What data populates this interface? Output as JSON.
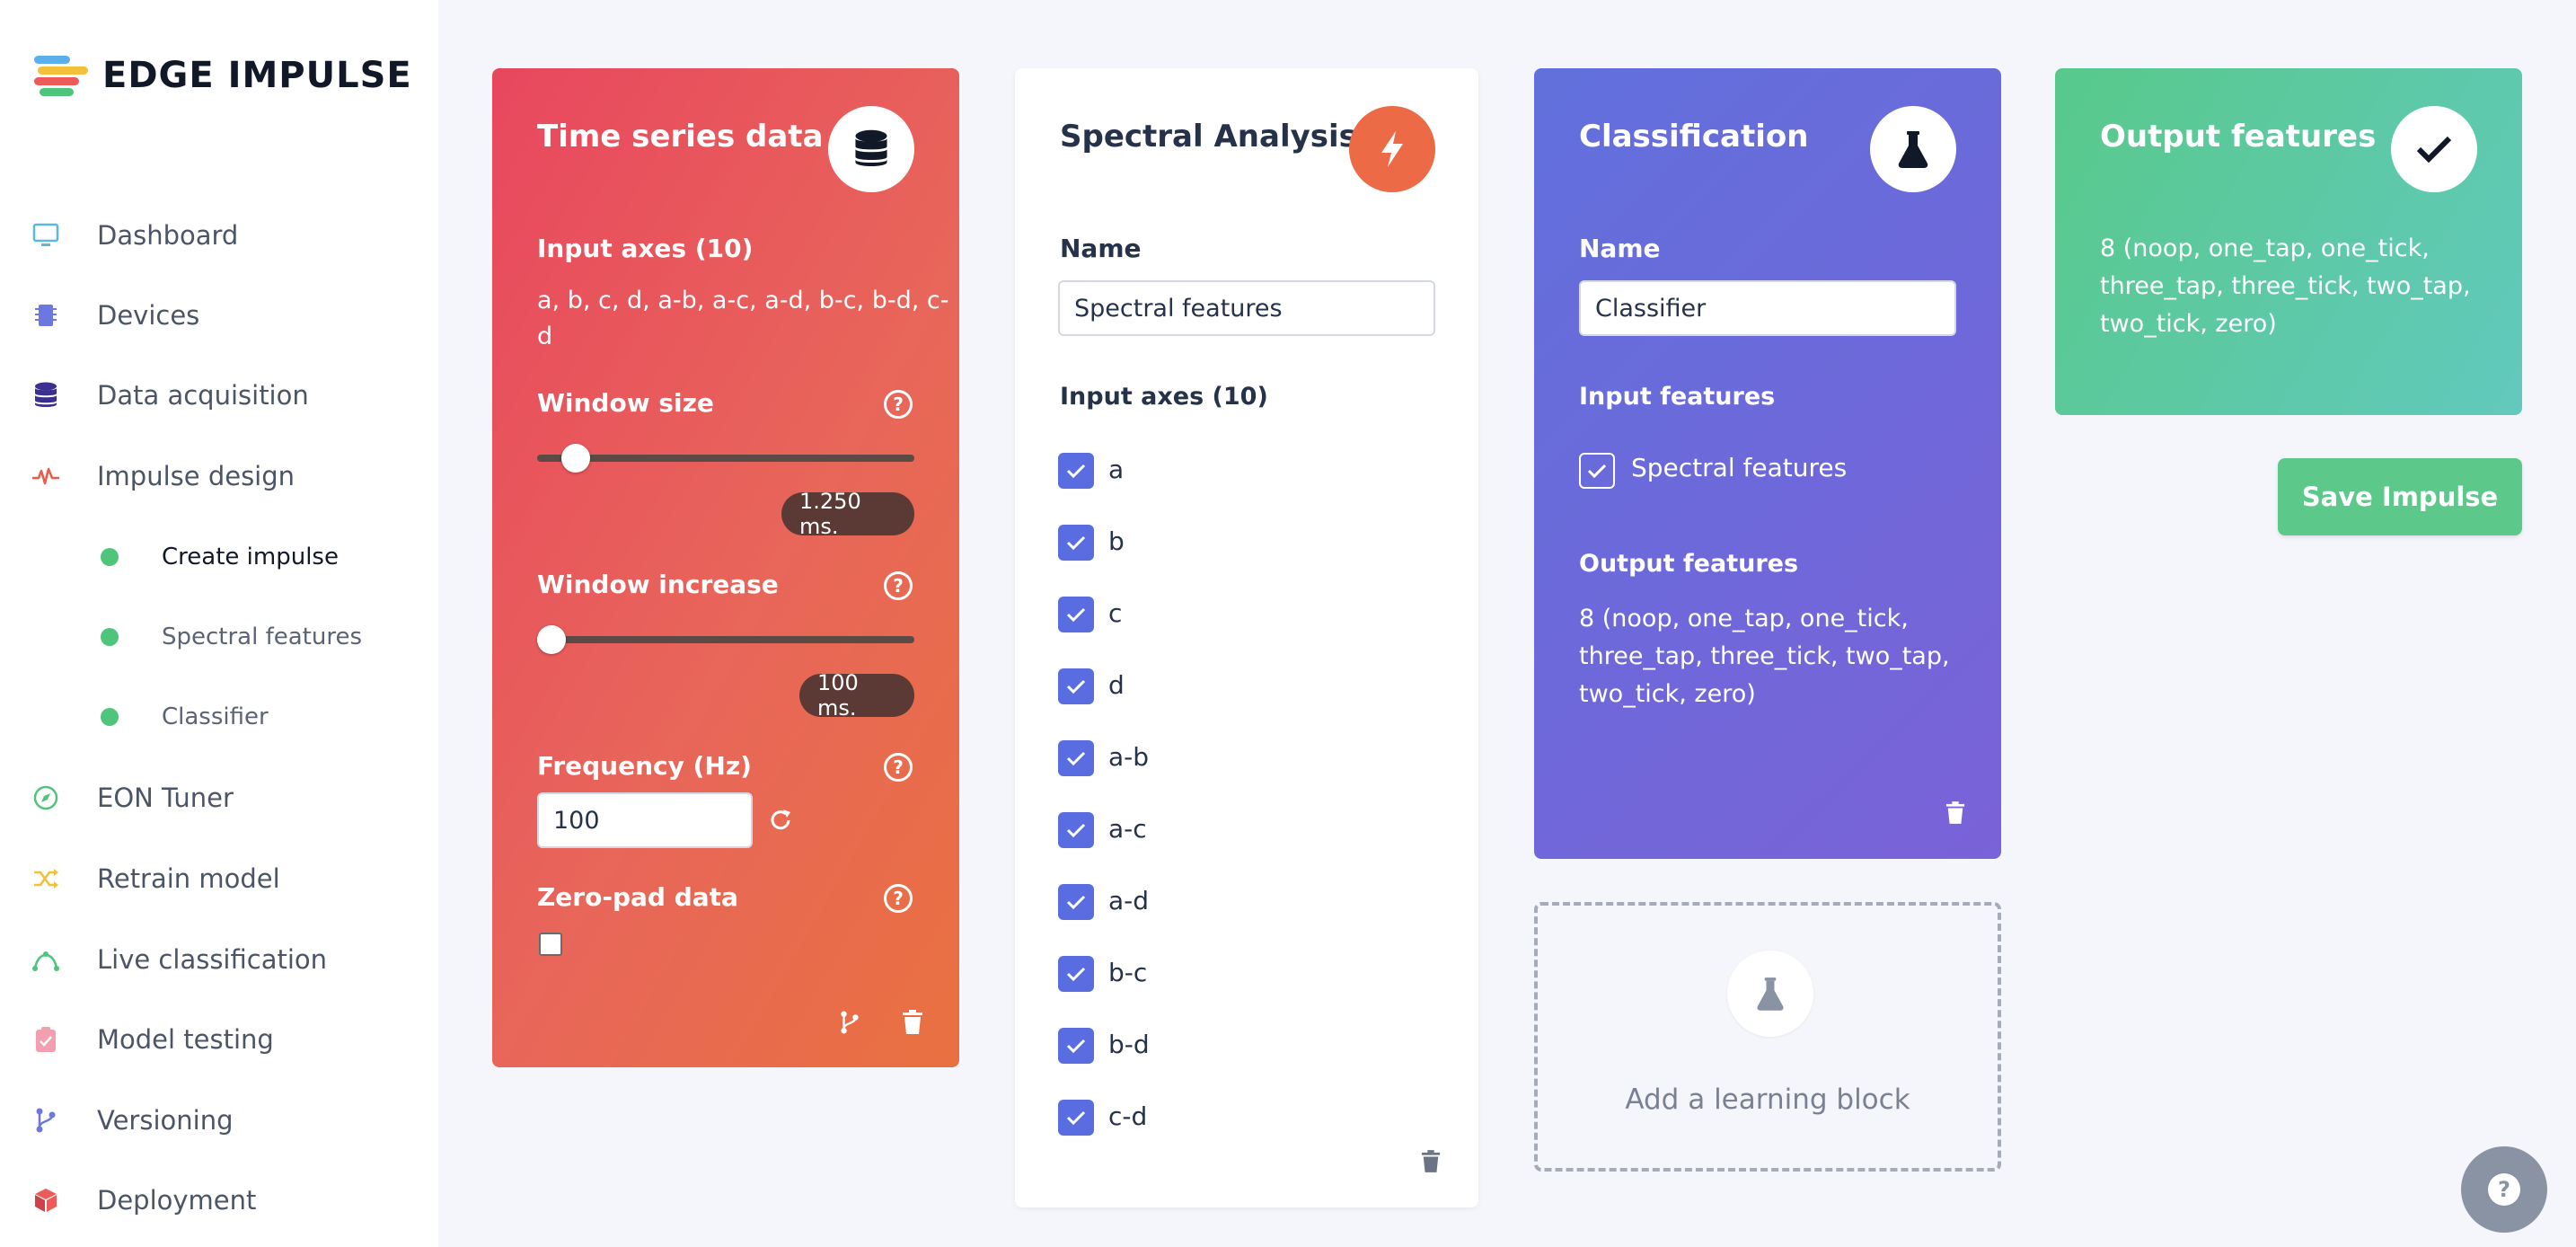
{
  "app": {
    "brand": "EDGE IMPULSE"
  },
  "sidebar": {
    "items": [
      {
        "label": "Dashboard",
        "icon": "monitor-icon"
      },
      {
        "label": "Devices",
        "icon": "chip-icon"
      },
      {
        "label": "Data acquisition",
        "icon": "database-icon"
      },
      {
        "label": "Impulse design",
        "icon": "pulse-icon"
      },
      {
        "label": "EON Tuner",
        "icon": "compass-icon"
      },
      {
        "label": "Retrain model",
        "icon": "shuffle-icon"
      },
      {
        "label": "Live classification",
        "icon": "curve-icon"
      },
      {
        "label": "Model testing",
        "icon": "clipboard-check-icon"
      },
      {
        "label": "Versioning",
        "icon": "branch-icon"
      },
      {
        "label": "Deployment",
        "icon": "box-icon"
      }
    ],
    "subitems": [
      {
        "label": "Create impulse",
        "active": true
      },
      {
        "label": "Spectral features",
        "active": false
      },
      {
        "label": "Classifier",
        "active": false
      }
    ]
  },
  "time_series": {
    "title": "Time series data",
    "input_axes_label": "Input axes (10)",
    "input_axes_line1": "a, b, c, d, a-b, a-c, a-d, b-c, b-d, c-",
    "input_axes_line2": "d",
    "window_size_label": "Window size",
    "window_size_value": "1.250 ms.",
    "window_size_fraction": 0.07,
    "window_increase_label": "Window increase",
    "window_increase_value": "100 ms.",
    "window_increase_fraction": 0.0,
    "frequency_label": "Frequency (Hz)",
    "frequency_value": "100",
    "zero_pad_label": "Zero-pad data",
    "zero_pad_checked": false
  },
  "spectral": {
    "title": "Spectral Analysis",
    "name_label": "Name",
    "name_value": "Spectral features",
    "input_axes_label": "Input axes (10)",
    "axes": [
      "a",
      "b",
      "c",
      "d",
      "a-b",
      "a-c",
      "a-d",
      "b-c",
      "b-d",
      "c-d"
    ]
  },
  "classification": {
    "title": "Classification",
    "name_label": "Name",
    "name_value": "Classifier",
    "input_features_label": "Input features",
    "input_feature": "Spectral features",
    "output_features_label": "Output features",
    "output_line1": "8 (noop, one_tap, one_tick,",
    "output_line2": "three_tap, three_tick, two_tap,",
    "output_line3": "two_tick, zero)"
  },
  "add_block": {
    "label": "Add a learning block"
  },
  "output_features": {
    "title": "Output features",
    "line1": "8 (noop, one_tap, one_tick,",
    "line2": "three_tap, three_tick, two_tap,",
    "line3": "two_tick, zero)"
  },
  "save_button": {
    "label": "Save Impulse"
  },
  "help_button": {
    "icon": "question-icon"
  },
  "colors": {
    "time_series": "#e8475e",
    "spectral_badge": "#ec6a45",
    "classification": "#6a6adc",
    "output": "#5ec9a4",
    "checkbox": "#5a6de0",
    "save": "#5cc98a"
  }
}
